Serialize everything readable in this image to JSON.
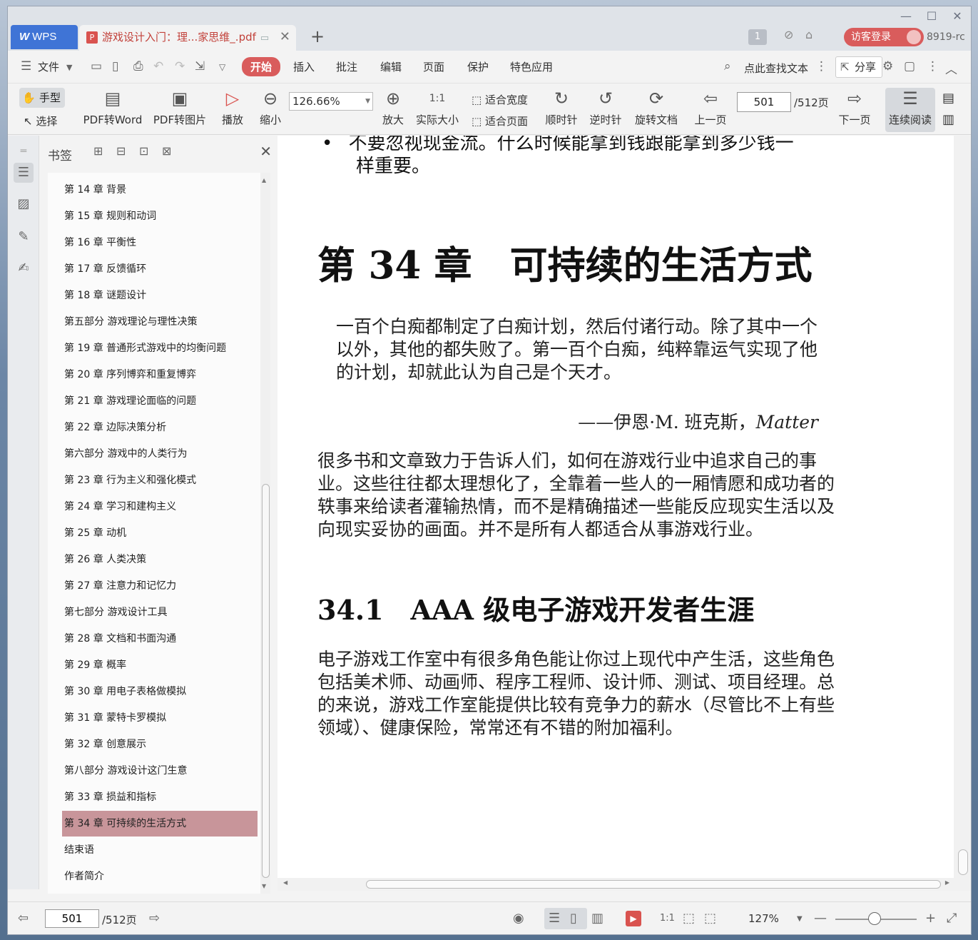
{
  "titlebar": {
    "app_tab": "WPS",
    "app_logo": "W",
    "doc_tab": "游戏设计入门：理...家思维_.pdf",
    "badge": "1",
    "login": "访客登录",
    "user_id": "8919-rc"
  },
  "menubar": {
    "file": "文件",
    "tabs": [
      "开始",
      "插入",
      "批注",
      "编辑",
      "页面",
      "保护",
      "特色应用"
    ],
    "search": "点此查找文本",
    "share": "分享"
  },
  "ribbon": {
    "hand": "手型",
    "select": "选择",
    "pdf_to_word": "PDF转Word",
    "pdf_to_image": "PDF转图片",
    "play": "播放",
    "zoom_out": "缩小",
    "zoom_value": "126.66%",
    "zoom_in": "放大",
    "actual_size": "实际大小",
    "fit_width": "适合宽度",
    "fit_page": "适合页面",
    "clockwise": "顺时针",
    "counter_clockwise": "逆时针",
    "rotate_doc": "旋转文档",
    "prev_page": "上一页",
    "page_current": "501",
    "page_total": "/512页",
    "next_page": "下一页",
    "continuous": "连续阅读"
  },
  "bookmarks": {
    "title": "书签",
    "items": [
      "第 14 章 背景",
      "第 15 章 规则和动词",
      "第 16 章 平衡性",
      "第 17 章 反馈循环",
      "第 18 章 谜题设计",
      "第五部分 游戏理论与理性决策",
      "第 19 章 普通形式游戏中的均衡问题",
      "第 20 章 序列博弈和重复博弈",
      "第 21 章 游戏理论面临的问题",
      "第 22 章 边际决策分析",
      "第六部分 游戏中的人类行为",
      "第 23 章 行为主义和强化模式",
      "第 24 章 学习和建构主义",
      "第 25 章 动机",
      "第 26 章 人类决策",
      "第 27 章 注意力和记忆力",
      "第七部分 游戏设计工具",
      "第 28 章 文档和书面沟通",
      "第 29 章 概率",
      "第 30 章 用电子表格做模拟",
      "第 31 章 蒙特卡罗模拟",
      "第 32 章 创意展示",
      "第八部分 游戏设计这门生意",
      "第 33 章 损益和指标",
      "第 34 章 可持续的生活方式",
      "结束语",
      "作者简介"
    ],
    "selected_index": 24
  },
  "document": {
    "bullet_line1": "不要忽视现金流。什么时候能拿到钱跟能拿到多少钱一",
    "bullet_line2": "样重要。",
    "chapter_title": "第 34 章　可持续的生活方式",
    "epigraph": "一百个白痴都制定了白痴计划，然后付诸行动。除了其中一个以外，其他的都失败了。第一百个白痴，纯粹靠运气实现了他的计划，却就此认为自己是个天才。",
    "attribution_prefix": "——伊恩·M. 班克斯，",
    "attribution_work": "Matter",
    "para1": "很多书和文章致力于告诉人们，如何在游戏行业中追求自己的事业。这些往往都太理想化了，全靠着一些人的一厢情愿和成功者的轶事来给读者灌输热情，而不是精确描述一些能反应现实生活以及向现实妥协的画面。并不是所有人都适合从事游戏行业。",
    "section_title": "34.1　AAA 级电子游戏开发者生涯",
    "para2": "电子游戏工作室中有很多角色能让你过上现代中产生活，这些角色包括美术师、动画师、程序工程师、设计师、测试、项目经理。总的来说，游戏工作室能提供比较有竞争力的薪水（尽管比不上有些领域）、健康保险，常常还有不错的附加福利。"
  },
  "statusbar": {
    "page_current": "501",
    "page_total": "/512页",
    "zoom": "127%"
  },
  "colors": {
    "accent": "#d95c5c",
    "wps_blue": "#3f74d6",
    "bookmark_selected": "#c8959a"
  }
}
